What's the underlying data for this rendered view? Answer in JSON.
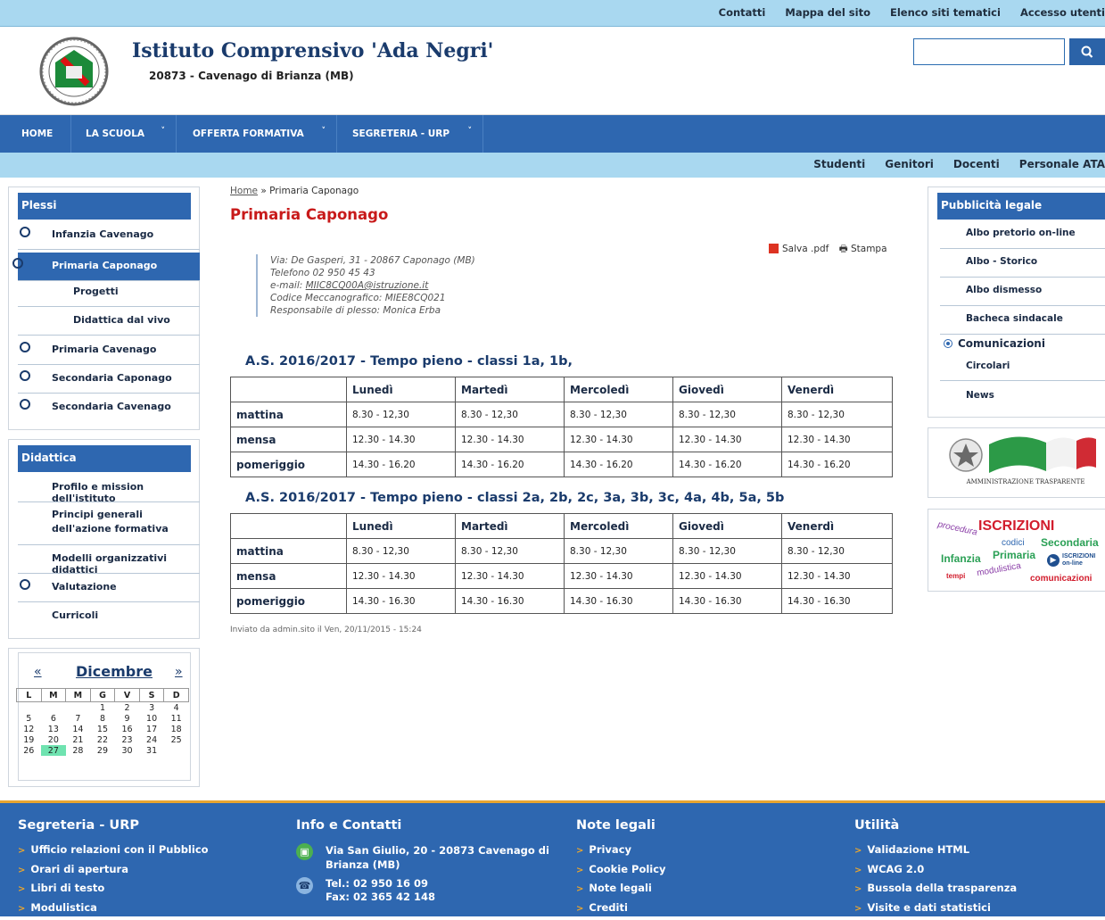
{
  "topbar": {
    "links": [
      "Contatti",
      "Mappa del sito",
      "Elenco siti tematici",
      "Accesso utenti"
    ]
  },
  "header": {
    "title": "Istituto Comprensivo 'Ada Negri'",
    "subtitle": "20873 - Cavenago di Brianza (MB)",
    "search": {
      "value": "",
      "icon": "search-icon"
    }
  },
  "nav": {
    "items": [
      "HOME",
      "LA SCUOLA",
      "OFFERTA FORMATIVA",
      "SEGRETERIA - URP"
    ],
    "chevron": "˅"
  },
  "subnav": {
    "links": [
      "Studenti",
      "Genitori",
      "Docenti",
      "Personale ATA"
    ]
  },
  "plessi": {
    "title": "Plessi",
    "items": [
      "Infanzia Cavenago",
      "Primaria Caponago",
      "Progetti",
      "Didattica dal vivo",
      "Primaria Cavenago",
      "Secondaria Caponago",
      "Secondaria Cavenago"
    ]
  },
  "didattica": {
    "title": "Didattica",
    "items": [
      "Profilo e mission dell'istituto",
      "Principi generali dell'azione formativa",
      "Modelli organizzativi didattici",
      "Valutazione",
      "Curricoli"
    ]
  },
  "calendar": {
    "month": "Dicembre",
    "prev": "«",
    "next": "»",
    "weekdays": [
      "L",
      "M",
      "M",
      "G",
      "V",
      "S",
      "D"
    ],
    "weeks": [
      [
        "",
        "",
        "",
        "1",
        "2",
        "3",
        "4"
      ],
      [
        "5",
        "6",
        "7",
        "8",
        "9",
        "10",
        "11"
      ],
      [
        "12",
        "13",
        "14",
        "15",
        "16",
        "17",
        "18"
      ],
      [
        "19",
        "20",
        "21",
        "22",
        "23",
        "24",
        "25"
      ],
      [
        "26",
        "27",
        "28",
        "29",
        "30",
        "31",
        ""
      ]
    ],
    "today": "27"
  },
  "content": {
    "breadcrumb_home": "Home",
    "breadcrumb_sep": " » ",
    "breadcrumb_current": "Primaria Caponago",
    "title": "Primaria Caponago",
    "pdf_label": "Salva .pdf",
    "print_label": "Stampa",
    "info": {
      "address": "Via: De Gasperi, 31 - 20867 Caponago (MB)",
      "phone": "Telefono 02 950 45 43",
      "email_label": "e-mail: ",
      "email": "MIIC8CQ00A@istruzione.it",
      "code": "Codice Meccanografico: MIEE8CQ021",
      "manager": "Responsabile di plesso: Monica Erba"
    },
    "schedule1": {
      "title": "A.S. 2016/2017 - Tempo pieno - classi 1a, 1b,",
      "days": [
        "Lunedì",
        "Martedì",
        "Mercoledì",
        "Giovedì",
        "Venerdì"
      ],
      "rows": [
        {
          "label": "mattina",
          "cells": [
            "8.30 - 12,30",
            "8.30 - 12,30",
            "8.30 - 12,30",
            "8.30 - 12,30",
            "8.30 - 12,30"
          ]
        },
        {
          "label": "mensa",
          "cells": [
            "12.30 - 14.30",
            "12.30 - 14.30",
            "12.30 - 14.30",
            "12.30 - 14.30",
            "12.30 - 14.30"
          ]
        },
        {
          "label": "pomeriggio",
          "cells": [
            "14.30 - 16.20",
            "14.30 - 16.20",
            "14.30 - 16.20",
            "14.30 - 16.20",
            "14.30 - 16.20"
          ]
        }
      ]
    },
    "schedule2": {
      "title": "A.S. 2016/2017 - Tempo pieno - classi 2a, 2b, 2c, 3a, 3b, 3c, 4a, 4b, 5a, 5b",
      "days": [
        "Lunedì",
        "Martedì",
        "Mercoledì",
        "Giovedì",
        "Venerdì"
      ],
      "rows": [
        {
          "label": "mattina",
          "cells": [
            "8.30 - 12,30",
            "8.30 - 12,30",
            "8.30 - 12,30",
            "8.30 - 12,30",
            "8.30 - 12,30"
          ]
        },
        {
          "label": "mensa",
          "cells": [
            "12.30 - 14.30",
            "12.30 - 14.30",
            "12.30 - 14.30",
            "12.30 - 14.30",
            "12.30 - 14.30"
          ]
        },
        {
          "label": "pomeriggio",
          "cells": [
            "14.30 - 16.30",
            "14.30 - 16.30",
            "14.30 - 16.30",
            "14.30 - 16.30",
            "14.30 - 16.30"
          ]
        }
      ]
    },
    "posted": "Inviato da admin.sito il Ven, 20/11/2015 - 15:24"
  },
  "pubblicita": {
    "title": "Pubblicità legale",
    "items": [
      "Albo pretorio on-line",
      "Albo - Storico",
      "Albo dismesso",
      "Bacheca sindacale"
    ],
    "group": "Comunicazioni",
    "group_items": [
      "Circolari",
      "News"
    ]
  },
  "banner_trasparente": {
    "text": "AMMINISTRAZIONE TRASPARENTE"
  },
  "banner_iscrizioni": {
    "title": "ISCRIZIONI",
    "words": [
      "procedura",
      "codici",
      "Secondaria",
      "Infanzia",
      "Primaria",
      "ISCRIZIONI",
      "on-line",
      "tempi",
      "modulistica",
      "comunicazioni"
    ]
  },
  "footer": {
    "col1": {
      "title": "Segreteria - URP",
      "items": [
        "Ufficio relazioni con il Pubblico",
        "Orari di apertura",
        "Libri di testo",
        "Modulistica"
      ]
    },
    "col2": {
      "title": "Info e Contatti",
      "address1": "Via San Giulio, 20 - 20873 Cavenago di",
      "address2": "Brianza (MB)",
      "tel": "Tel.: 02 950 16 09",
      "fax": "Fax: 02 365 42 148"
    },
    "col3": {
      "title": "Note legali",
      "items": [
        "Privacy",
        "Cookie Policy",
        "Note legali",
        "Crediti"
      ]
    },
    "col4": {
      "title": "Utilità",
      "items": [
        "Validazione HTML",
        "WCAG 2.0",
        "Bussola della trasparenza",
        "Visite e dati statistici"
      ]
    }
  },
  "colors": {
    "brand_blue": "#2e67b0",
    "light_blue": "#a9d8f0",
    "title_red": "#c81a1a",
    "footer_accent": "#e8a530"
  }
}
